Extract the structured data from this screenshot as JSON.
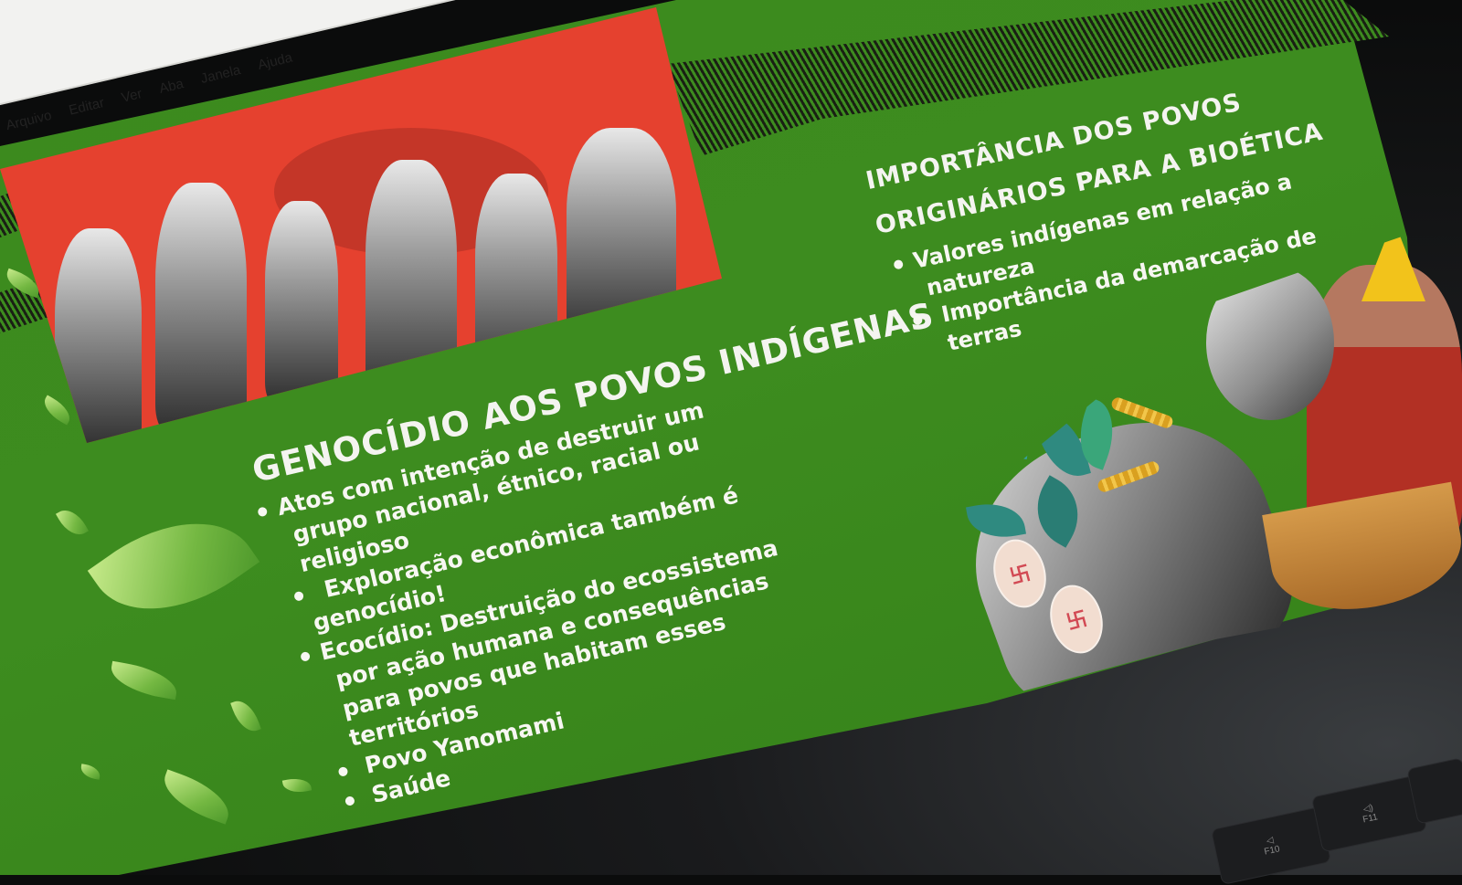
{
  "menu": {
    "items": [
      "Arquivo",
      "Editar",
      "Ver",
      "Aba",
      "Janela",
      "Ajuda"
    ]
  },
  "slide": {
    "left": {
      "heading": "GENOCÍDIO AOS POVOS INDÍGENAS",
      "bullets": [
        "Atos com intenção de destruir um",
        "grupo nacional, étnico, racial ou",
        "religioso",
        "Exploração econômica também é",
        "genocídio!",
        "Ecocídio: Destruição do ecossistema",
        "por ação humana e consequências",
        "para povos que habitam esses",
        "territórios",
        "Povo Yanomami",
        "Saúde"
      ]
    },
    "right": {
      "heading_line1": "IMPORTÂNCIA DOS POVOS",
      "heading_line2": "ORIGINÁRIOS PARA A BIOÉTICA",
      "bullets": [
        "Valores indígenas em relação a",
        "natureza",
        "Importância da demarcação de",
        "terras"
      ]
    },
    "colors": {
      "slide_green": "#3d8c1f",
      "photo_red": "#e5412f",
      "text": "#f7f7f2"
    }
  },
  "keyboard": {
    "keys": [
      "F10",
      "F11"
    ]
  }
}
